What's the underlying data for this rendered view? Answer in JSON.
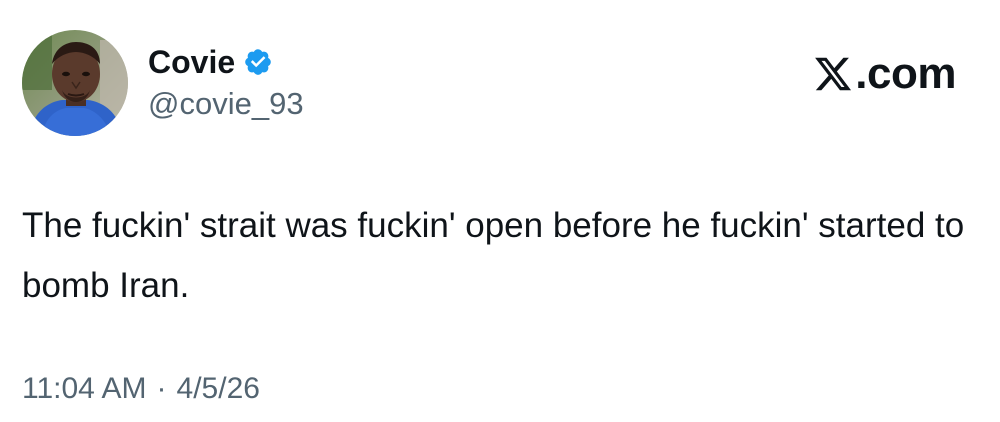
{
  "author": {
    "display_name": "Covie",
    "handle": "@covie_93",
    "verified": true,
    "verified_color": "#1d9bf0"
  },
  "brand": {
    "label": ".com",
    "icon": "x-logo-icon"
  },
  "tweet": {
    "text": "The fuckin' strait was fuckin' open before he fuckin' started to bomb Iran."
  },
  "meta": {
    "time": "11:04 AM",
    "separator": "·",
    "date": "4/5/26"
  },
  "colors": {
    "text_primary": "#0f1419",
    "text_secondary": "#536471",
    "background": "#ffffff"
  }
}
